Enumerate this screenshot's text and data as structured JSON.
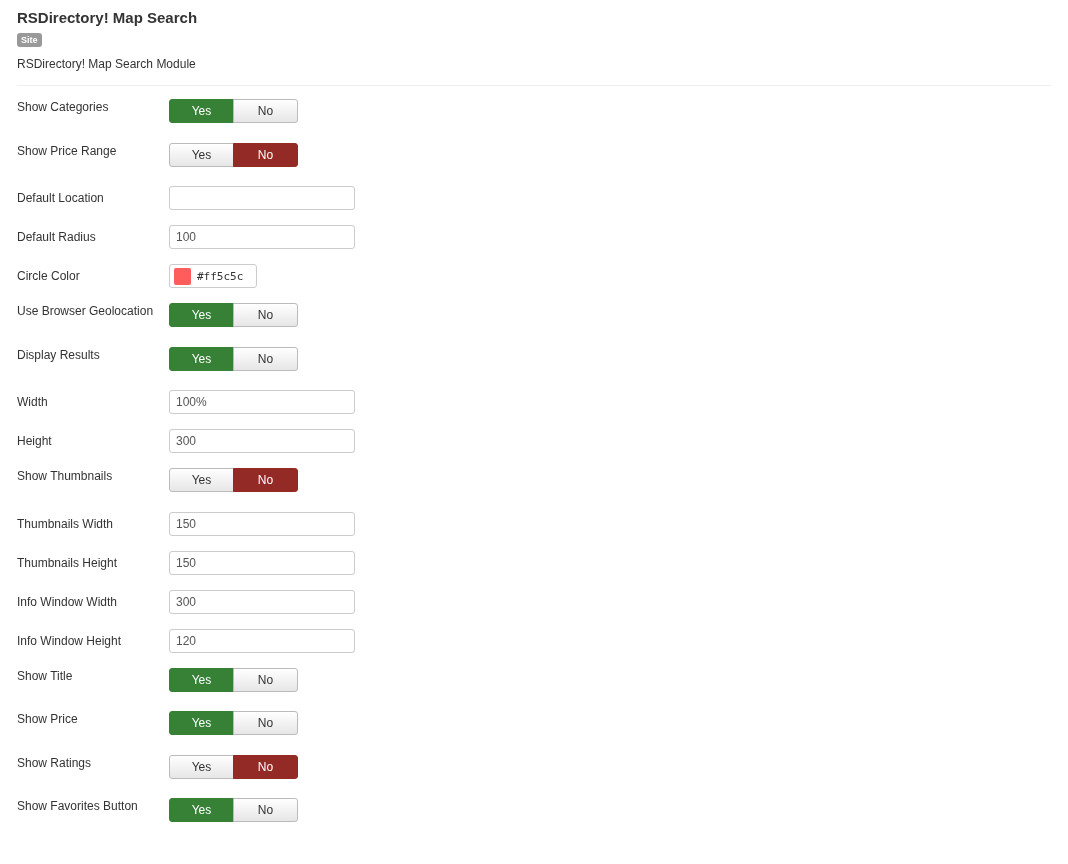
{
  "header": {
    "title": "RSDirectory! Map Search",
    "badge": "Site",
    "description": "RSDirectory! Map Search Module"
  },
  "fields": [
    {
      "kind": "toggle",
      "label": "Show Categories",
      "options": [
        {
          "label": "Yes",
          "selected": true
        },
        {
          "label": "No",
          "selected": false
        }
      ]
    },
    {
      "kind": "toggle",
      "label": "Show Price Range",
      "options": [
        {
          "label": "Yes",
          "selected": false
        },
        {
          "label": "No",
          "selected": true
        }
      ]
    },
    {
      "kind": "text",
      "label": "Default Location"
    },
    {
      "kind": "text",
      "label": "Default Radius",
      "value": "100"
    },
    {
      "kind": "color",
      "label": "Circle Color",
      "value": "#ff5c5c",
      "color": "#ff5c5c"
    },
    {
      "kind": "toggle",
      "label": "Use Browser Geolocation",
      "options": [
        {
          "label": "Yes",
          "selected": true
        },
        {
          "label": "No",
          "selected": false
        }
      ]
    },
    {
      "kind": "toggle",
      "label": "Display Results",
      "options": [
        {
          "label": "Yes",
          "selected": true
        },
        {
          "label": "No",
          "selected": false
        }
      ]
    },
    {
      "kind": "text",
      "label": "Width",
      "value": "100%"
    },
    {
      "kind": "text",
      "label": "Height",
      "value": "300"
    },
    {
      "kind": "toggle",
      "label": "Show Thumbnails",
      "options": [
        {
          "label": "Yes",
          "selected": false
        },
        {
          "label": "No",
          "selected": true
        }
      ]
    },
    {
      "kind": "text",
      "label": "Thumbnails Width",
      "value": "150"
    },
    {
      "kind": "text",
      "label": "Thumbnails Height",
      "value": "150"
    },
    {
      "kind": "text",
      "label": "Info Window Width",
      "value": "300"
    },
    {
      "kind": "text",
      "label": "Info Window Height",
      "value": "120"
    },
    {
      "kind": "toggle",
      "label": "Show Title",
      "options": [
        {
          "label": "Yes",
          "selected": true
        },
        {
          "label": "No",
          "selected": false
        }
      ]
    },
    {
      "kind": "toggle",
      "label": "Show Price",
      "options": [
        {
          "label": "Yes",
          "selected": true
        },
        {
          "label": "No",
          "selected": false
        }
      ]
    },
    {
      "kind": "toggle",
      "label": "Show Ratings",
      "options": [
        {
          "label": "Yes",
          "selected": false
        },
        {
          "label": "No",
          "selected": true
        }
      ]
    },
    {
      "kind": "toggle",
      "label": "Show Favorites Button",
      "options": [
        {
          "label": "Yes",
          "selected": true
        },
        {
          "label": "No",
          "selected": false
        }
      ]
    }
  ]
}
